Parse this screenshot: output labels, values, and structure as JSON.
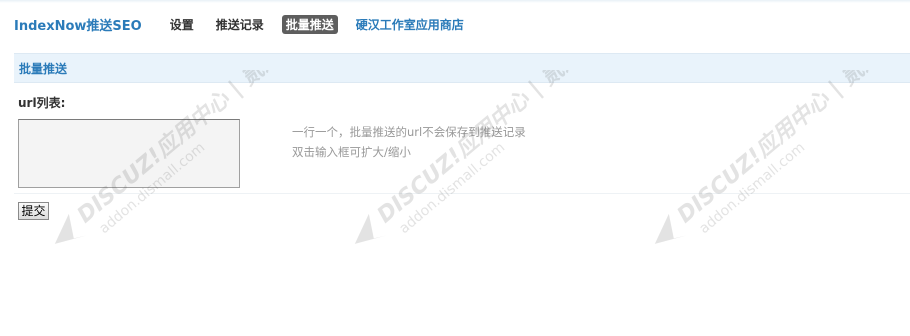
{
  "nav": {
    "brand": "IndexNow推送SEO",
    "items": [
      {
        "label": "设置",
        "active": false,
        "link": false
      },
      {
        "label": "推送记录",
        "active": false,
        "link": false
      },
      {
        "label": "批量推送",
        "active": true,
        "link": false
      },
      {
        "label": "硬汉工作室应用商店",
        "active": false,
        "link": true
      }
    ]
  },
  "section": {
    "title": "批量推送"
  },
  "form": {
    "url_label": "url列表:",
    "url_value": "",
    "hint_line1": "一行一个，批量推送的url不会保存到推送记录",
    "hint_line2": "双击输入框可扩大/缩小",
    "submit_label": "提交"
  },
  "watermark": {
    "line1": "DISCUZ!应用中心 | 贰道",
    "line2": "addon.dismall.com"
  },
  "colors": {
    "accent": "#2b7bb9",
    "active_tab_bg": "#5e5e5e",
    "section_bg": "#e9f3fb"
  }
}
